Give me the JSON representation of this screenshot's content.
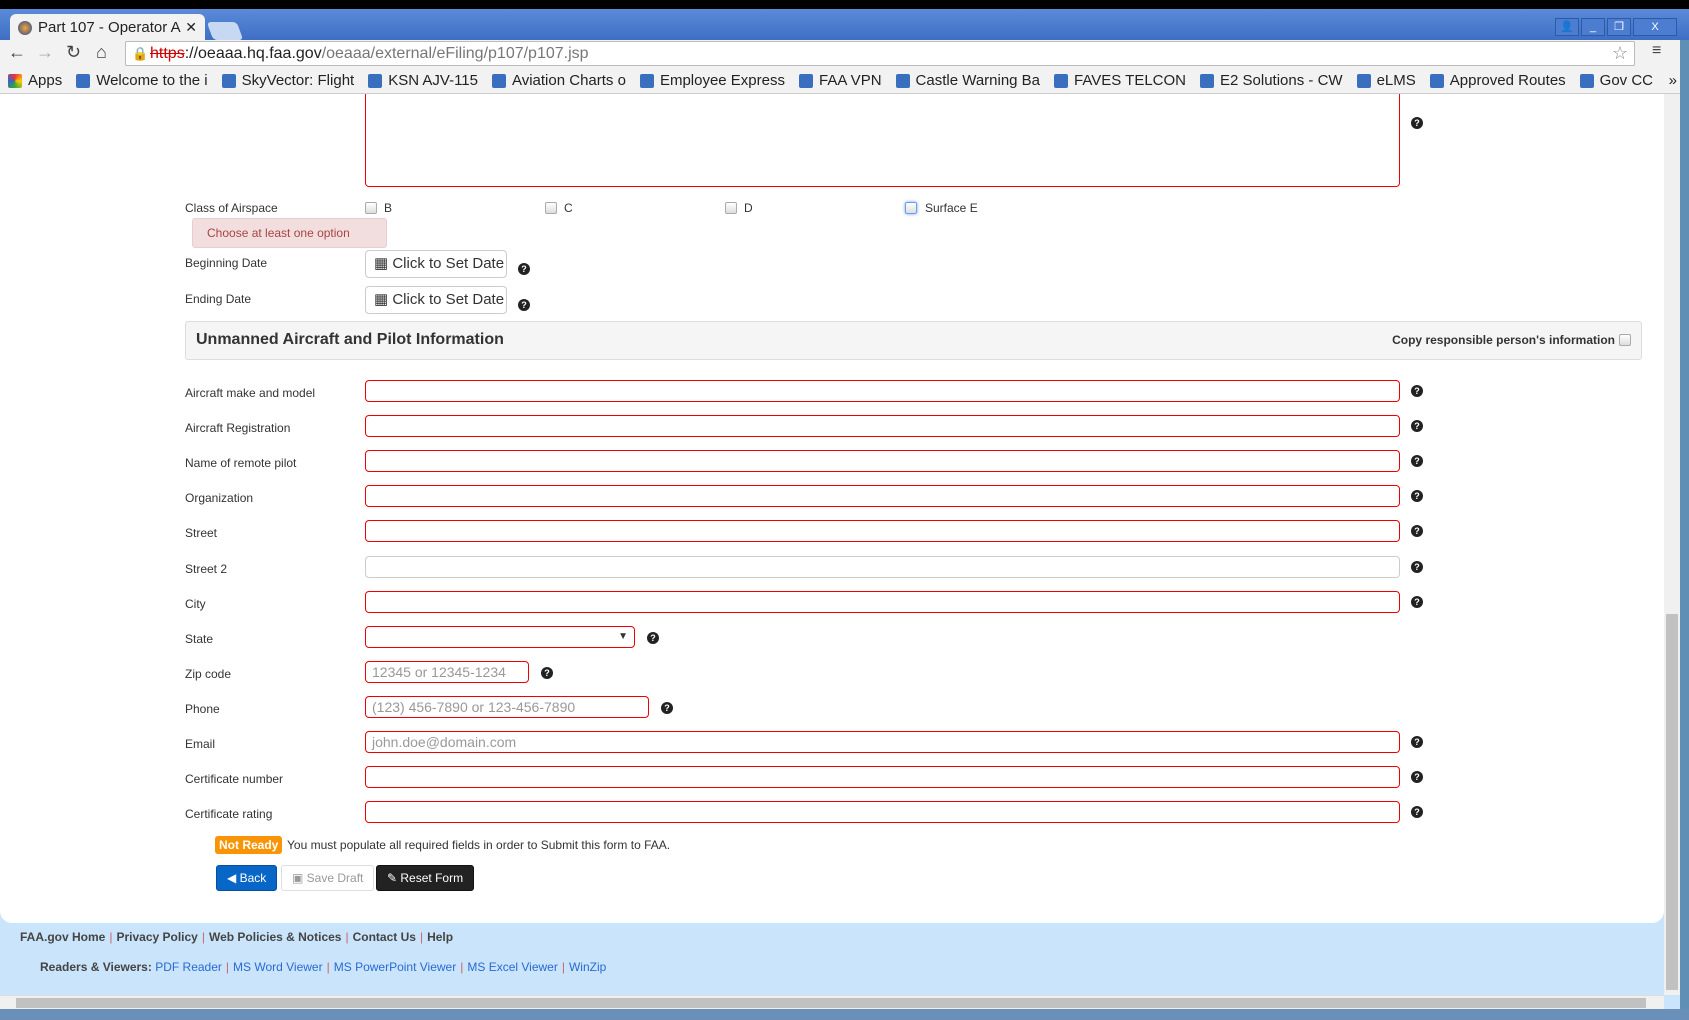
{
  "browser": {
    "tab_title": "Part 107 - Operator A",
    "url_scheme": "https",
    "url_host": "://oeaaa.hq.faa.gov",
    "url_path": "/oeaaa/external/eFiling/p107/p107.jsp",
    "bookmarks": [
      "Apps",
      "Welcome to the i",
      "SkyVector: Flight",
      "KSN AJV-115",
      "Aviation Charts o",
      "Employee Express",
      "FAA VPN",
      "Castle Warning Ba",
      "FAVES TELCON",
      "E2 Solutions - CW",
      "eLMS",
      "Approved Routes",
      "Gov CC"
    ],
    "more": "»"
  },
  "form": {
    "airspace_label": "Class of Airspace",
    "airspace_options": [
      "B",
      "C",
      "D",
      "Surface E"
    ],
    "airspace_error": "Choose at least one option",
    "begin_label": "Beginning Date",
    "end_label": "Ending Date",
    "date_button": "Click to Set Date",
    "section_title": "Unmanned Aircraft and Pilot Information",
    "copy_label": "Copy responsible person's information",
    "fields": [
      {
        "label": "Aircraft make and model",
        "placeholder": ""
      },
      {
        "label": "Aircraft Registration",
        "placeholder": ""
      },
      {
        "label": "Name of remote pilot",
        "placeholder": ""
      },
      {
        "label": "Organization",
        "placeholder": ""
      },
      {
        "label": "Street",
        "placeholder": ""
      },
      {
        "label": "Street 2",
        "placeholder": ""
      },
      {
        "label": "City",
        "placeholder": ""
      },
      {
        "label": "State",
        "placeholder": ""
      },
      {
        "label": "Zip code",
        "placeholder": "12345 or 12345-1234"
      },
      {
        "label": "Phone",
        "placeholder": "(123) 456-7890 or 123-456-7890"
      },
      {
        "label": "Email",
        "placeholder": "john.doe@domain.com"
      },
      {
        "label": "Certificate number",
        "placeholder": ""
      },
      {
        "label": "Certificate rating",
        "placeholder": ""
      }
    ],
    "status_badge": "Not Ready",
    "status_text": "You must populate all required fields in order to Submit this form to FAA.",
    "back": "Back",
    "save": "Save Draft",
    "reset": "Reset Form"
  },
  "footer": {
    "links": [
      "FAA.gov Home",
      "Privacy Policy",
      "Web Policies & Notices",
      "Contact Us",
      "Help"
    ],
    "readers_label": "Readers & Viewers:",
    "readers": [
      "PDF Reader",
      "MS Word Viewer",
      "MS PowerPoint Viewer",
      "MS Excel Viewer",
      "WinZip"
    ]
  }
}
